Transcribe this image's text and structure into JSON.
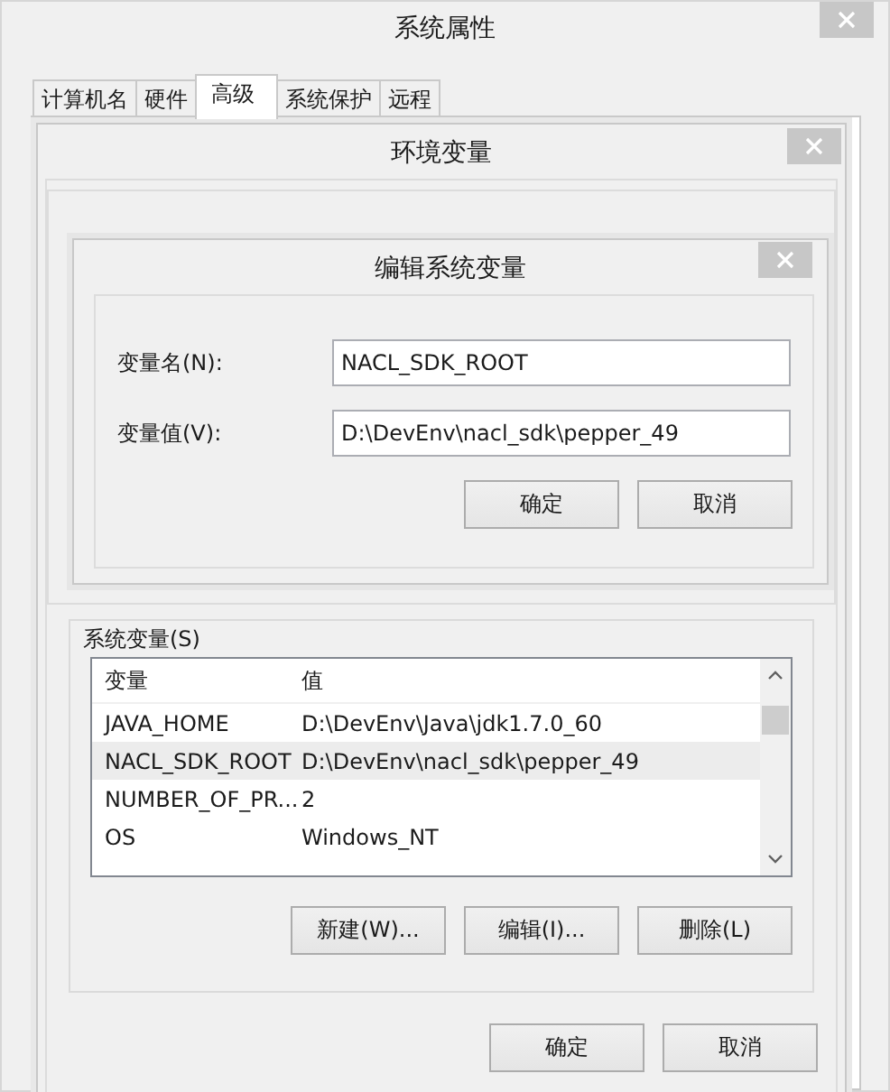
{
  "window": {
    "title": "系统属性"
  },
  "tabs": [
    {
      "label": "计算机名",
      "selected": false
    },
    {
      "label": "硬件",
      "selected": false
    },
    {
      "label": "高级",
      "selected": true
    },
    {
      "label": "系统保护",
      "selected": false
    },
    {
      "label": "远程",
      "selected": false
    }
  ],
  "env_window": {
    "title": "环境变量",
    "system_variables": {
      "label": "系统变量(S)",
      "columns": [
        "变量",
        "值"
      ],
      "rows": [
        {
          "name": "JAVA_HOME",
          "value": "D:\\DevEnv\\Java\\jdk1.7.0_60",
          "selected": false
        },
        {
          "name": "NACL_SDK_ROOT",
          "value": "D:\\DevEnv\\nacl_sdk\\pepper_49",
          "selected": true
        },
        {
          "name": "NUMBER_OF_PR...",
          "value": "2",
          "selected": false
        },
        {
          "name": "OS",
          "value": "Windows_NT",
          "selected": false
        }
      ],
      "buttons": [
        "新建(W)...",
        "编辑(I)...",
        "删除(L)"
      ]
    },
    "buttons": [
      "确定",
      "取消"
    ]
  },
  "edit_dialog": {
    "title": "编辑系统变量",
    "fields": [
      {
        "label": "变量名(N):",
        "value": "NACL_SDK_ROOT"
      },
      {
        "label": "变量值(V):",
        "value": "D:\\DevEnv\\nacl_sdk\\pepper_49"
      }
    ],
    "buttons": [
      "确定",
      "取消"
    ]
  }
}
